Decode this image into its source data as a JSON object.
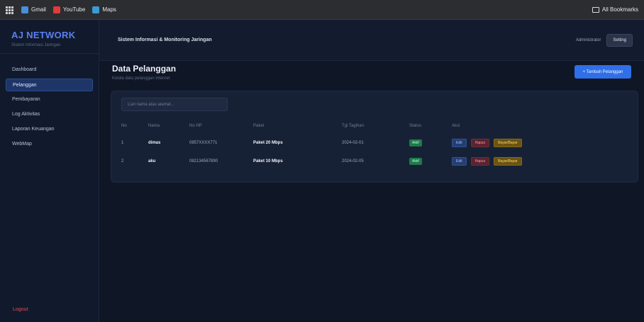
{
  "bookmarks": {
    "items": [
      {
        "label": "Gmail",
        "icon": "gmail-icon",
        "color": "#4a8fd8"
      },
      {
        "label": "YouTube",
        "icon": "youtube-icon",
        "color": "#e03a3a"
      },
      {
        "label": "Maps",
        "icon": "maps-icon",
        "color": "#3a9bd6"
      }
    ],
    "all_bookmarks": "All Bookmarks"
  },
  "sidebar": {
    "brand": "AJ NETWORK",
    "brand_sub": "Sistem Informasi Jaringan",
    "items": [
      {
        "label": "Dashboard"
      },
      {
        "label": "Pelanggan"
      },
      {
        "label": "Pembayaran"
      },
      {
        "label": "Log Aktivitas"
      },
      {
        "label": "Laporan Keuangan"
      },
      {
        "label": "WebMap"
      }
    ],
    "active_index": 1,
    "logout": "Logout"
  },
  "topbar": {
    "title": "Sistem Informasi & Monitoring Jaringan",
    "user": "Administrator",
    "setting": "Setting"
  },
  "page": {
    "title": "Data Pelanggan",
    "subtitle": "Kelola data pelanggan internet",
    "add_button": "+ Tambah Pelanggan"
  },
  "table": {
    "search_placeholder": "Cari nama atau alamat...",
    "headers": [
      "No",
      "Nama",
      "No HP",
      "Paket",
      "Tgl Tagihan",
      "Status",
      "Aksi"
    ],
    "rows": [
      {
        "no": "1",
        "nama": "dimas",
        "hp": "0857XXXX771",
        "paket": "Paket 20 Mbps",
        "tgl": "2024-02-01",
        "status": "Aktif"
      },
      {
        "no": "2",
        "nama": "aku",
        "hp": "082134567890",
        "paket": "Paket 10 Mbps",
        "tgl": "2024-02-05",
        "status": "Aktif"
      }
    ],
    "actions": {
      "edit": "Edit",
      "hapus": "Hapus",
      "bayar": "Bayar/Bayar"
    }
  },
  "colors": {
    "accent": "#2f6fe8",
    "brand": "#5b7ff0",
    "status_active": "#1f7a4b",
    "danger": "#e0505a"
  }
}
